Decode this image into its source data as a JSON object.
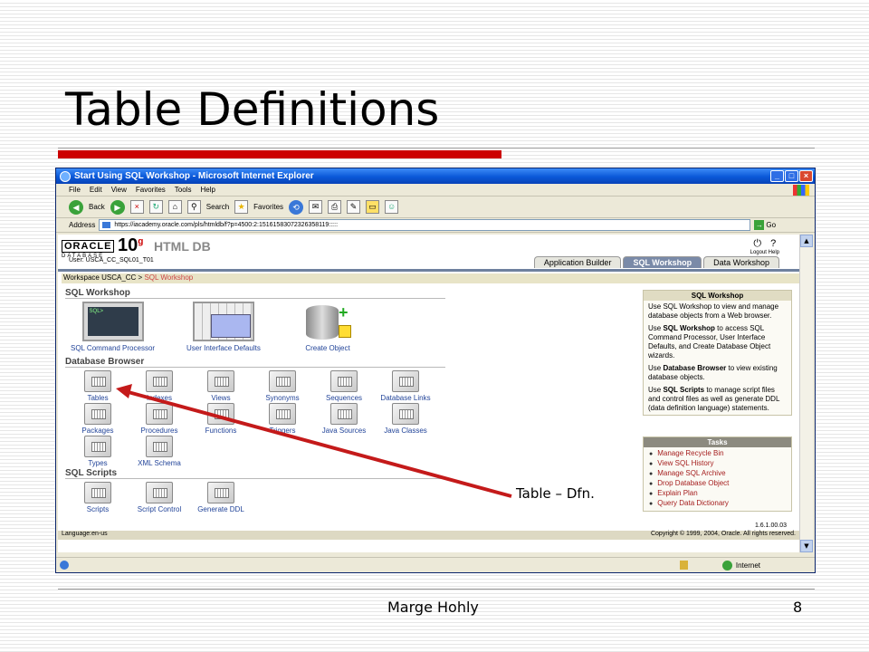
{
  "slide": {
    "title": "Table Definitions",
    "author": "Marge Hohly",
    "page_number": "8",
    "callout": "Table – Dfn.",
    "accent_color": "#cc0000"
  },
  "window": {
    "title": "Start Using SQL Workshop - Microsoft Internet Explorer",
    "menu": [
      "File",
      "Edit",
      "View",
      "Favorites",
      "Tools",
      "Help"
    ],
    "toolbar": {
      "back": "Back",
      "search": "Search",
      "favorites": "Favorites"
    },
    "address_label": "Address",
    "address_url": "https://iacademy.oracle.com/pls/htmldb/f?p=4500:2:15161583072326358119:::::",
    "go_label": "Go",
    "status_zone": "Internet"
  },
  "app": {
    "brand_oracle": "ORACLE",
    "brand_database": "DATABASE",
    "brand_10": "10",
    "brand_g": "g",
    "brand_htmldb": "HTML DB",
    "user_line": "User: USCA_CC_SQL01_T01",
    "logout_label": "Logout",
    "help_label": "Help",
    "tabs": [
      "Application Builder",
      "SQL Workshop",
      "Data Workshop"
    ],
    "breadcrumb_workspace": "Workspace USCA_CC > ",
    "breadcrumb_current": "SQL Workshop",
    "sections": {
      "sql_workshop": "SQL Workshop",
      "database_browser": "Database Browser",
      "sql_scripts": "SQL Scripts"
    },
    "workshop_icons": [
      "SQL Command Processor",
      "User Interface Defaults",
      "Create Object"
    ],
    "browser_icons": [
      "Tables",
      "Indexes",
      "Views",
      "Synonyms",
      "Sequences",
      "Database Links",
      "Packages",
      "Procedures",
      "Functions",
      "Triggers",
      "Java Sources",
      "Java Classes",
      "Types",
      "XML Schema"
    ],
    "script_icons": [
      "Scripts",
      "Script Control",
      "Generate DDL"
    ],
    "info_panel": {
      "title": "SQL Workshop",
      "p1": "Use SQL Workshop to view and manage database objects from a Web browser.",
      "p2_pre": "Use ",
      "p2_bold": "SQL Workshop",
      "p2_post": " to access SQL Command Processor, User Interface Defaults, and Create Database Object wizards.",
      "p3_pre": "Use ",
      "p3_bold": "Database Browser",
      "p3_post": " to view existing database objects.",
      "p4_pre": "Use ",
      "p4_bold": "SQL Scripts",
      "p4_post": " to manage script files and control files as well as generate DDL (data definition language) statements."
    },
    "tasks_panel": {
      "title": "Tasks",
      "items": [
        "Manage Recycle Bin",
        "View SQL History",
        "Manage SQL Archive",
        "Drop Database Object",
        "Explain Plan",
        "Query Data Dictionary"
      ]
    },
    "version": "1.6.1.00.03",
    "language": "Language:en-us",
    "copyright": "Copyright © 1999, 2004, Oracle. All rights reserved."
  }
}
